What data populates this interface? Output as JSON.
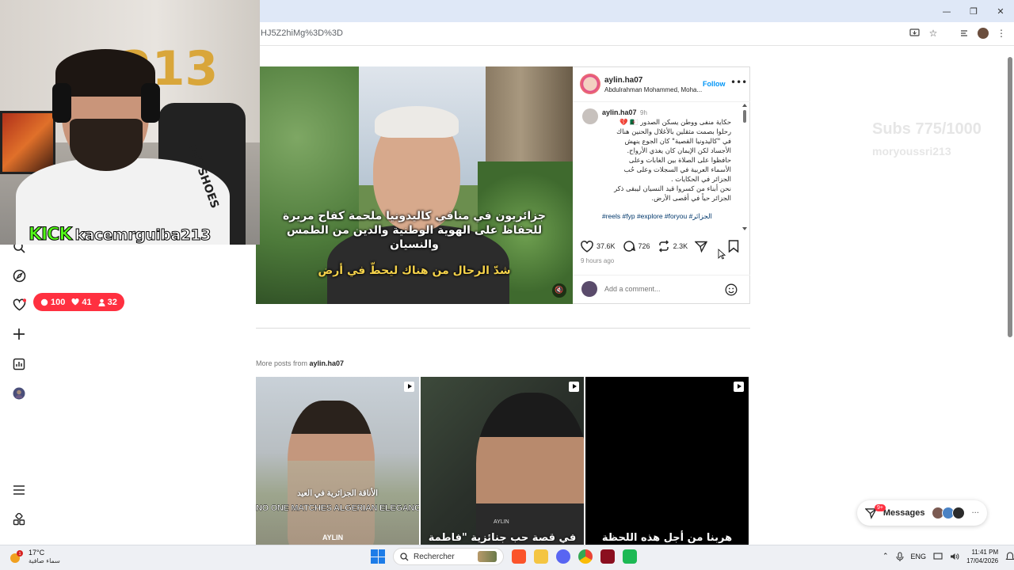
{
  "browser": {
    "url_fragment": "HJ5Z2hiMg%3D%3D",
    "window_controls": [
      "—",
      "❐",
      "✕"
    ]
  },
  "stream_overlay": {
    "platform": "KICK",
    "channel": "kacemrguiba213",
    "shirt_text": "NETSHOES",
    "balloon_text": "213",
    "notifications": {
      "comments": "100",
      "likes": "41",
      "followers": "32"
    },
    "sub_goal": "Subs 775/1000",
    "sub_name": "moryoussri213"
  },
  "post": {
    "username": "aylin.ha07",
    "subtitle": "Abdulrahman Mohammed, Moha...",
    "follow_label": "Follow",
    "time": "9h",
    "caption_lines": [
      "حكاية منفى ووطن يسكن الصدور 🇩🇿 💔",
      "رحلوا بصمت مثقلين بالأغلال والحنين هناك",
      "في \"كاليدونيا القصية\" كان الجوع ينهش",
      "الأجساد لكن الإيمان كان يغذي الأرواح.",
      "حافظوا على الصلاة بين الغابات وعلى",
      "الأسماء العربية في السجلات وعلى حُب",
      "الجزائر في الحكايات .",
      "نحن أبناء من كسروا قيد النسيان ليبقى ذكر",
      "الجزائر حياً في أقصى الأرض."
    ],
    "hashtags": "#reels #fyp #explore #foryou #الجزائر",
    "likes": "37.6K",
    "comments": "726",
    "reposts": "2.3K",
    "posted_ago": "9 hours ago",
    "comment_placeholder": "Add a comment...",
    "video_caption_line1": "جزائريون في منافي كاليدونيا ملحمة كفاح مريرة",
    "video_caption_line2": "للحفاظ على الهوية الوطنية والدين من الطمس والنسيان",
    "video_caption_yellow": "شدّ الرحال من هناك ليحطّ في أرض"
  },
  "more_posts": {
    "prefix": "More posts from ",
    "username": "aylin.ha07",
    "thumbs": [
      {
        "caption_ar": "الأناقة الجزائرية في العيد",
        "caption_en": "NO ONE MATCHES ALGERIAN ELEGANCE ON EID",
        "watermark": "AYLIN"
      },
      {
        "caption_ar": "في قصة حب جنائزية \"فاطمة",
        "watermark": "AYLIN"
      },
      {
        "caption_ar": "هربنا من أجل هذه اللحظة"
      }
    ]
  },
  "messages": {
    "label": "Messages",
    "badge": "9+"
  },
  "taskbar": {
    "temperature": "17°C",
    "weather": "سماء صافية",
    "weather_badge": "1",
    "search_placeholder": "Rechercher",
    "language": "ENG",
    "time": "11:41 PM",
    "date": "17/04/2026"
  },
  "colors": {
    "instagram_blue": "#0095f6",
    "notif_red": "#ff3040",
    "kick_green": "#53fc18"
  }
}
